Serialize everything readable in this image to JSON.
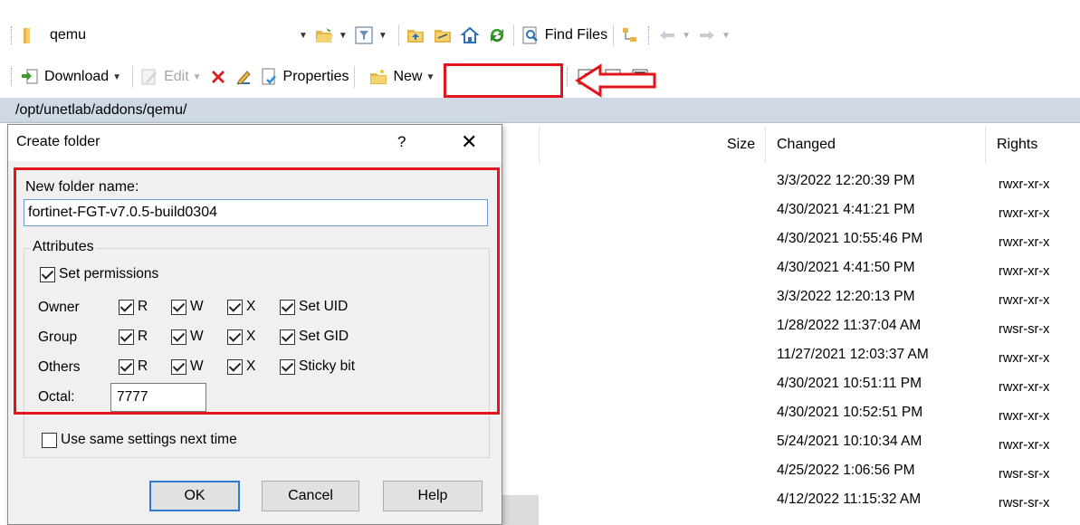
{
  "toolbar1": {
    "location": "qemu",
    "find_files": "Find Files"
  },
  "toolbar2": {
    "download": "Download",
    "edit": "Edit",
    "properties": "Properties",
    "new": "New"
  },
  "path": "/opt/unetlab/addons/qemu/",
  "file_list": {
    "headers": {
      "size": "Size",
      "changed": "Changed",
      "rights": "Rights"
    },
    "rows": [
      {
        "changed": "3/3/2022 12:20:39 PM",
        "rights": "rwxr-xr-x"
      },
      {
        "changed": "4/30/2021 4:41:21 PM",
        "rights": "rwxr-xr-x"
      },
      {
        "changed": "4/30/2021 10:55:46 PM",
        "rights": "rwxr-xr-x"
      },
      {
        "changed": "4/30/2021 4:41:50 PM",
        "rights": "rwxr-xr-x"
      },
      {
        "changed": "3/3/2022 12:20:13 PM",
        "rights": "rwxr-xr-x"
      },
      {
        "changed": "1/28/2022 11:37:04 AM",
        "rights": "rwsr-sr-x"
      },
      {
        "changed": "11/27/2021 12:03:37 AM",
        "rights": "rwxr-xr-x"
      },
      {
        "changed": "4/30/2021 10:51:11 PM",
        "rights": "rwxr-xr-x"
      },
      {
        "changed": "4/30/2021 10:52:51 PM",
        "rights": "rwxr-xr-x"
      },
      {
        "changed": "5/24/2021 10:10:34 AM",
        "rights": "rwxr-xr-x"
      },
      {
        "changed": "4/25/2022 1:06:56 PM",
        "rights": "rwsr-sr-x"
      },
      {
        "changed": "4/12/2022 11:15:32 AM",
        "rights": "rwsr-sr-x"
      }
    ]
  },
  "dialog": {
    "title": "Create folder",
    "help_glyph": "?",
    "close_glyph": "✕",
    "new_folder_label": "New folder name:",
    "new_folder_value": "fortinet-FGT-v7.0.5-build0304",
    "attributes_label": "Attributes",
    "set_permissions": "Set permissions",
    "owner": "Owner",
    "group": "Group",
    "others": "Others",
    "r": "R",
    "w": "W",
    "x": "X",
    "set_uid": "Set UID",
    "set_gid": "Set GID",
    "sticky_bit": "Sticky bit",
    "octal_label": "Octal:",
    "octal_value": "7777",
    "use_same": "Use same settings next time",
    "ok": "OK",
    "cancel": "Cancel",
    "help": "Help"
  },
  "colors": {
    "highlight": "#e3141b",
    "path_bar": "#cfd8e3",
    "dialog_bg": "#f0f0f0",
    "accent": "#2f78d6"
  }
}
